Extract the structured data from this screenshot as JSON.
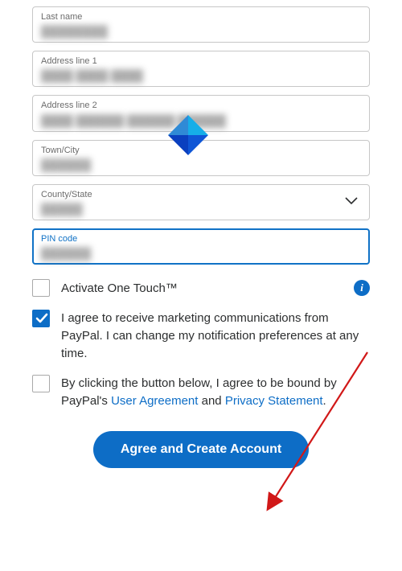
{
  "fields": {
    "last_name": {
      "label": "Last name"
    },
    "address1": {
      "label": "Address line 1"
    },
    "address2": {
      "label": "Address line 2"
    },
    "town": {
      "label": "Town/City"
    },
    "county": {
      "label": "County/State"
    },
    "pin": {
      "label": "PIN code"
    }
  },
  "one_touch": {
    "label": "Activate One Touch™",
    "checked": false
  },
  "marketing": {
    "checked": true,
    "text": "I agree to receive marketing communications from PayPal. I can change my notification preferences at any time."
  },
  "terms": {
    "checked": false,
    "prefix": "By clicking the button below, I agree to be bound by PayPal's ",
    "link1": "User Agreement",
    "mid": " and ",
    "link2": "Privacy Statement",
    "suffix": "."
  },
  "cta": "Agree and Create Account",
  "icons": {
    "info": "i"
  }
}
